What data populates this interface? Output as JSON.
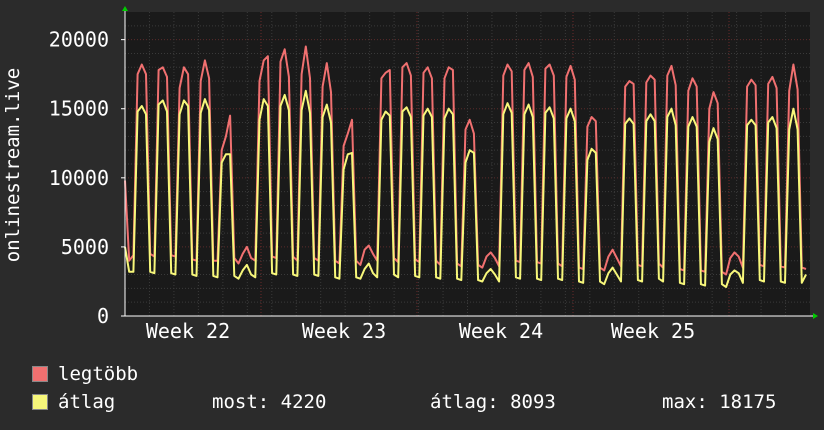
{
  "chart_data": {
    "type": "line",
    "ylabel": "onlinestream.live",
    "ylim": [
      0,
      22000
    ],
    "yticks": [
      0,
      5000,
      10000,
      15000,
      20000
    ],
    "x_tick_labels": [
      "Week 22",
      "Week 23",
      "Week 24",
      "Week 25"
    ],
    "grid": true,
    "legend_placement": "bottom-left",
    "series": [
      {
        "name": "legtöbb",
        "color": "#f07070",
        "values": [
          9800,
          4000,
          4400,
          17500,
          18200,
          17500,
          4500,
          4300,
          17800,
          18000,
          17300,
          4400,
          4300,
          16500,
          18000,
          17500,
          4100,
          4000,
          17000,
          18500,
          17200,
          4000,
          4000,
          12000,
          13000,
          14500,
          4200,
          3800,
          4500,
          5000,
          4200,
          4000,
          17000,
          18500,
          18800,
          4300,
          4200,
          18400,
          19300,
          17300,
          4300,
          4000,
          17500,
          19500,
          17200,
          4200,
          4000,
          16600,
          18300,
          16200,
          4000,
          3800,
          12300,
          13200,
          14200,
          4000,
          3700,
          4800,
          5100,
          4500,
          4000,
          17200,
          17600,
          17800,
          4200,
          3900,
          18000,
          18300,
          17400,
          4100,
          3900,
          17600,
          18000,
          17200,
          4000,
          3700,
          17200,
          18000,
          17800,
          3800,
          3600,
          13500,
          14200,
          13200,
          3700,
          3500,
          4300,
          4600,
          4200,
          3600,
          17400,
          18200,
          17700,
          4000,
          3900,
          17800,
          18300,
          17300,
          3900,
          3800,
          17900,
          18200,
          17400,
          3800,
          3600,
          17300,
          18100,
          17100,
          3500,
          3400,
          13700,
          14400,
          14100,
          3500,
          3300,
          4300,
          4800,
          4200,
          3600,
          16600,
          17000,
          16800,
          3700,
          3600,
          16900,
          17400,
          17100,
          3800,
          3500,
          17400,
          18100,
          16700,
          3400,
          3300,
          16300,
          17200,
          16600,
          3300,
          3200,
          15000,
          16200,
          15400,
          3200,
          3000,
          4200,
          4600,
          4300,
          3500,
          16600,
          17100,
          16700,
          3700,
          3600,
          16800,
          17300,
          16500,
          3600,
          3500,
          16300,
          18200,
          16400,
          3500,
          3400
        ],
        "note_stat": "max: 18175"
      },
      {
        "name": "átlag",
        "color": "#f7f77a",
        "values": [
          5000,
          3200,
          3200,
          14800,
          15200,
          14600,
          3200,
          3100,
          15300,
          15600,
          14800,
          3100,
          3000,
          14600,
          15600,
          15200,
          3000,
          2900,
          14700,
          15700,
          14900,
          2900,
          2800,
          11100,
          11700,
          11700,
          2900,
          2700,
          3300,
          3700,
          3000,
          2800,
          14200,
          15700,
          15200,
          3100,
          3000,
          15200,
          16000,
          14900,
          3000,
          2900,
          14900,
          16300,
          14700,
          3000,
          2900,
          14400,
          15300,
          14000,
          2800,
          2700,
          10600,
          11700,
          11800,
          2800,
          2700,
          3400,
          3800,
          3100,
          2800,
          14200,
          14800,
          14500,
          3000,
          2800,
          14800,
          15100,
          14400,
          2900,
          2800,
          14500,
          15000,
          14400,
          2800,
          2700,
          14300,
          15000,
          14600,
          2700,
          2600,
          11100,
          12000,
          11800,
          2600,
          2500,
          3100,
          3400,
          3000,
          2500,
          14600,
          15400,
          14700,
          2800,
          2700,
          14600,
          15300,
          14400,
          2700,
          2600,
          14700,
          15100,
          14300,
          2700,
          2600,
          14300,
          15000,
          14100,
          2500,
          2400,
          11300,
          12100,
          11800,
          2500,
          2300,
          3100,
          3500,
          3000,
          2500,
          13900,
          14300,
          13900,
          2600,
          2500,
          14100,
          14600,
          14100,
          2700,
          2500,
          14400,
          15000,
          13800,
          2400,
          2300,
          13700,
          14400,
          13700,
          2300,
          2200,
          12600,
          13600,
          12800,
          2300,
          2100,
          3000,
          3300,
          3100,
          2400,
          13800,
          14200,
          13800,
          2600,
          2500,
          14000,
          14400,
          13600,
          2500,
          2400,
          13500,
          15000,
          13500,
          2400,
          3000
        ]
      }
    ],
    "stats": {
      "most": "most: 4220",
      "atlag": "átlag: 8093",
      "max": "max: 18175"
    }
  },
  "colors": {
    "background": "#2b2b2b",
    "plot_bg": "#1a1a1a",
    "axis": "#ffffff",
    "arrow": "#00cc00",
    "grid_minor": "#3a3a3a",
    "grid_major_v": "#6b2a2a"
  }
}
